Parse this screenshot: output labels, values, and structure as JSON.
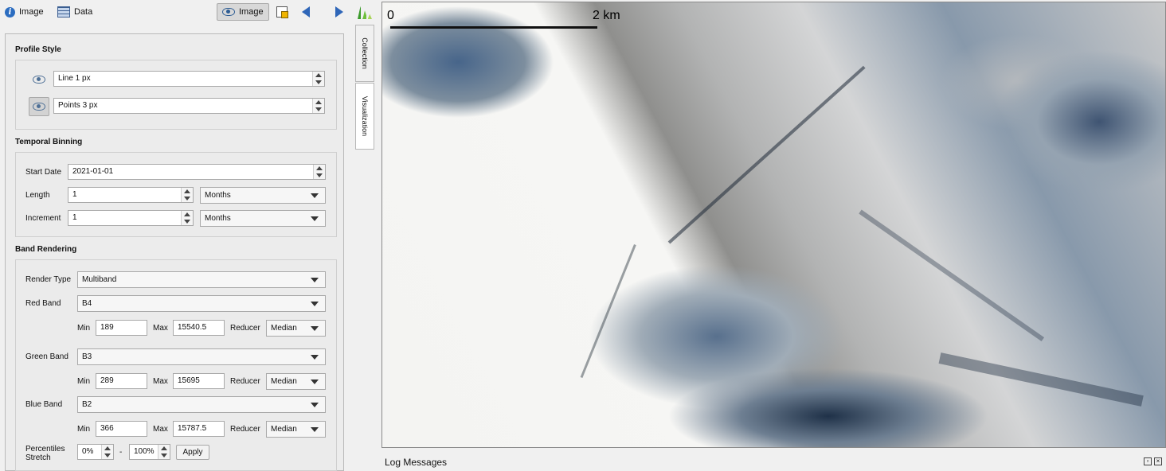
{
  "toolbar": {
    "image_tab": "Image",
    "data_tab": "Data",
    "image_view_button": "Image"
  },
  "side_tabs": {
    "collection": "Collection",
    "visualization": "Visualization"
  },
  "profile_style": {
    "title": "Profile Style",
    "line_value": "Line 1 px",
    "points_value": "Points 3 px"
  },
  "temporal_binning": {
    "title": "Temporal Binning",
    "start_date_label": "Start Date",
    "start_date_value": "2021-01-01",
    "length_label": "Length",
    "length_value": "1",
    "length_unit": "Months",
    "increment_label": "Increment",
    "increment_value": "1",
    "increment_unit": "Months"
  },
  "band_rendering": {
    "title": "Band Rendering",
    "render_type_label": "Render Type",
    "render_type_value": "Multiband",
    "min_label": "Min",
    "max_label": "Max",
    "reducer_label": "Reducer",
    "red": {
      "label": "Red Band",
      "band": "B4",
      "min": "189",
      "max": "15540.5",
      "reducer": "Median"
    },
    "green": {
      "label": "Green Band",
      "band": "B3",
      "min": "289",
      "max": "15695",
      "reducer": "Median"
    },
    "blue": {
      "label": "Blue Band",
      "band": "B2",
      "min": "366",
      "max": "15787.5",
      "reducer": "Median"
    },
    "percentiles_label_1": "Percentiles",
    "percentiles_label_2": "Stretch",
    "pct_low": "0%",
    "pct_sep": "-",
    "pct_high": "100%",
    "apply_label": "Apply"
  },
  "map": {
    "scale_start": "0",
    "scale_end": "2 km"
  },
  "log": {
    "title": "Log Messages"
  }
}
